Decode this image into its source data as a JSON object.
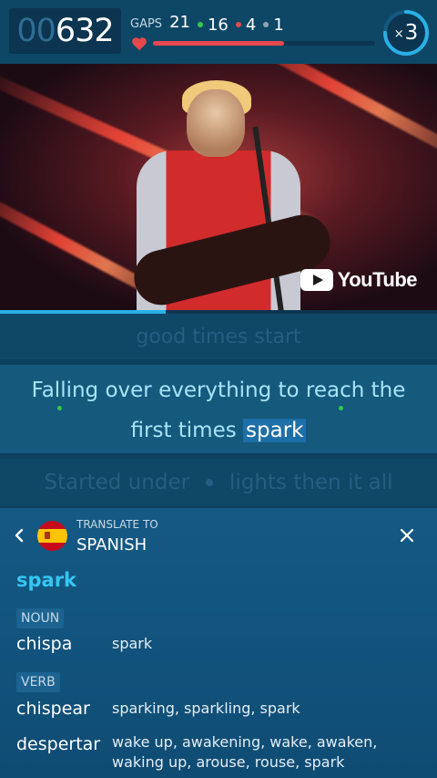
{
  "header": {
    "score_lead": "00",
    "score_main": "632",
    "gaps_label": "GAPS",
    "gaps_total": "21",
    "correct": "16",
    "wrong": "4",
    "skipped": "1",
    "progress_fraction": 0.59,
    "multiplier_prefix": "×",
    "multiplier_value": "3",
    "multiplier_fraction": 0.75
  },
  "video": {
    "youtube_label": "YouTube",
    "progress_fraction": 0.38
  },
  "lyrics": {
    "previous": "good times start",
    "current_line1": "Falling over everything to reach the",
    "current_line2_before": "first times ",
    "current_gap": "spark",
    "next_part1": "Started under",
    "next_part2": "lights then it all"
  },
  "translate": {
    "label": "TRANSLATE TO",
    "language": "SPANISH",
    "word": "spark",
    "entries": [
      {
        "pos": "NOUN",
        "term": "chispa",
        "gloss": "spark"
      },
      {
        "pos": "VERB",
        "term": "chispear",
        "gloss": "sparking, sparkling, spark"
      },
      {
        "pos": "",
        "term": "despertar",
        "gloss": "wake up, awakening, wake, awaken, waking up, arouse, rouse, spark"
      }
    ]
  },
  "colors": {
    "accent": "#2ab0e6",
    "correct": "#35c94a",
    "wrong": "#e5484d"
  }
}
